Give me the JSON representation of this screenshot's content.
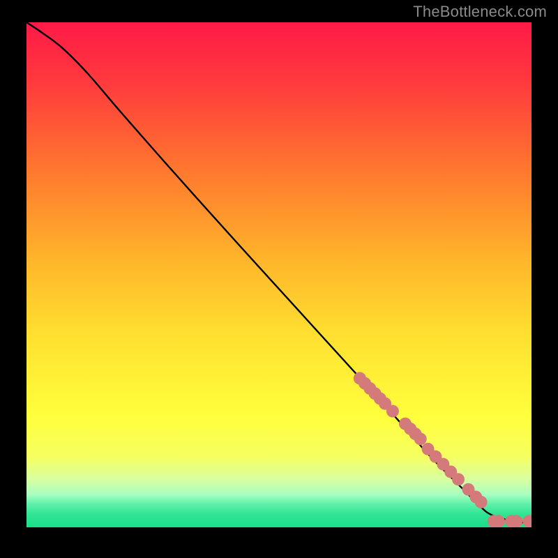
{
  "attribution": "TheBottleneck.com",
  "chart_data": {
    "type": "line",
    "title": "",
    "xlabel": "",
    "ylabel": "",
    "xlim": [
      0,
      100
    ],
    "ylim": [
      0,
      100
    ],
    "background_gradient": {
      "stops": [
        {
          "pos": 0.0,
          "color": "#ff1a47"
        },
        {
          "pos": 0.12,
          "color": "#ff3a3d"
        },
        {
          "pos": 0.3,
          "color": "#ff7a2e"
        },
        {
          "pos": 0.48,
          "color": "#ffb82a"
        },
        {
          "pos": 0.62,
          "color": "#ffe030"
        },
        {
          "pos": 0.78,
          "color": "#ffff3c"
        },
        {
          "pos": 0.86,
          "color": "#f6ff60"
        },
        {
          "pos": 0.905,
          "color": "#d8ffa0"
        },
        {
          "pos": 0.935,
          "color": "#a8ffc0"
        },
        {
          "pos": 0.955,
          "color": "#5cf0a8"
        },
        {
          "pos": 0.975,
          "color": "#2fe493"
        },
        {
          "pos": 1.0,
          "color": "#1adf8a"
        }
      ]
    },
    "series": [
      {
        "name": "curve",
        "type": "line",
        "color": "#000000",
        "x": [
          0,
          3,
          7,
          12,
          18,
          25,
          33,
          42,
          52,
          62,
          72,
          80,
          86,
          90,
          92,
          95,
          97,
          99,
          100
        ],
        "y": [
          100,
          98,
          95,
          90,
          83,
          75,
          66,
          56,
          45,
          34,
          23,
          14,
          8,
          4,
          2.5,
          1.5,
          1,
          1,
          1
        ]
      },
      {
        "name": "points",
        "type": "scatter",
        "color": "#d57a7a",
        "radius_px": 9,
        "x": [
          66,
          67,
          68,
          69,
          70,
          71,
          72.5,
          75,
          76,
          77,
          78,
          79.5,
          81,
          82.5,
          84,
          85.5,
          87.5,
          89,
          90,
          92.5,
          93.5,
          96,
          97,
          99.5
        ],
        "y": [
          29.5,
          28.5,
          27.5,
          26.5,
          25.5,
          24.5,
          23,
          20.5,
          19.5,
          18.5,
          17.5,
          15.5,
          14,
          12.5,
          11,
          9.5,
          7.5,
          6,
          5,
          1.2,
          1.2,
          1.2,
          1.2,
          1.2
        ]
      }
    ]
  }
}
